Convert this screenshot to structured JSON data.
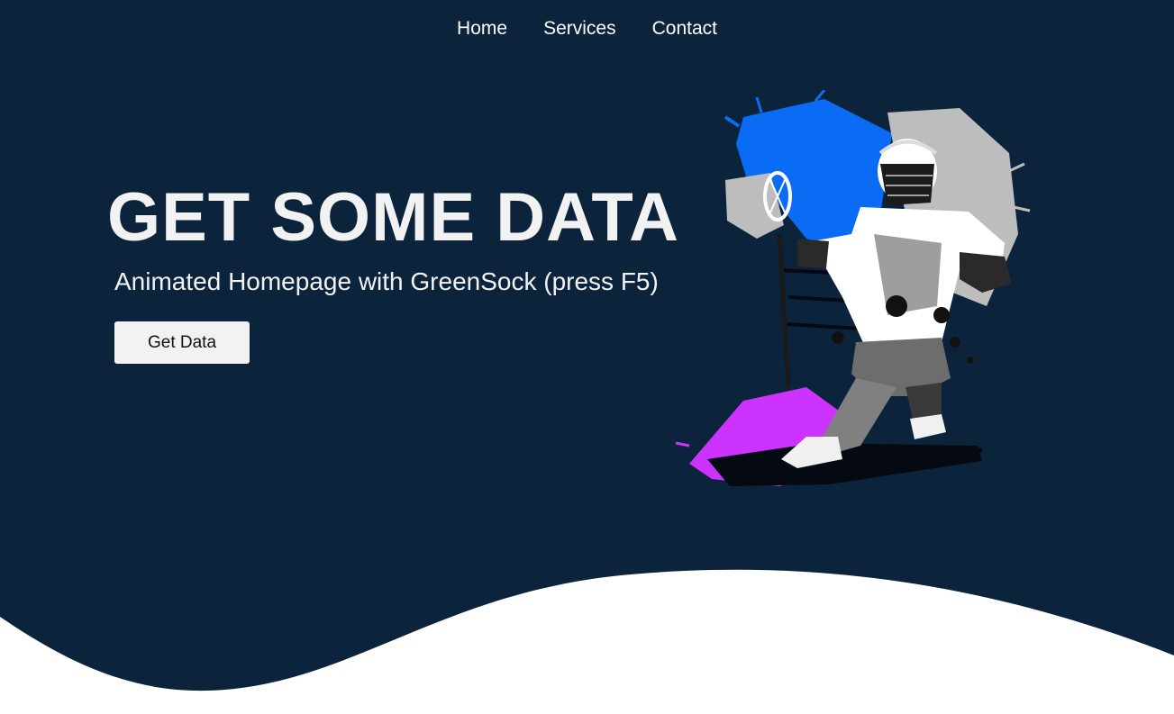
{
  "nav": {
    "items": [
      {
        "label": "Home"
      },
      {
        "label": "Services"
      },
      {
        "label": "Contact"
      }
    ]
  },
  "hero": {
    "title": "GET SOME DATA",
    "subtitle": "Animated Homepage with GreenSock (press F5)",
    "button_label": "Get Data",
    "image": "lacrosse-player-illustration"
  },
  "colors": {
    "background": "#0c243b",
    "text": "#f2f2f2",
    "button_bg": "#f2f2f2",
    "wave": "#ffffff",
    "paint_blue": "#0a6cf5",
    "paint_purple": "#cc33ff",
    "paint_grey": "#bdbdbd"
  }
}
